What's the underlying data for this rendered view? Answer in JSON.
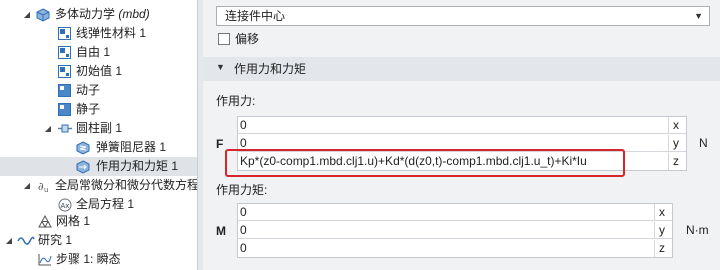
{
  "tree": {
    "items": [
      {
        "label": "多体动力学",
        "suffix": "(mbd)",
        "icon": "multibody-icon"
      },
      {
        "label": "线弹性材料 1",
        "icon": "material-icon"
      },
      {
        "label": "自由 1",
        "icon": "constraint-icon"
      },
      {
        "label": "初始值 1",
        "icon": "initial-values-icon"
      },
      {
        "label": "动子",
        "icon": "domain-icon"
      },
      {
        "label": "静子",
        "icon": "domain-icon"
      },
      {
        "label": "圆柱副 1",
        "icon": "cylindrical-joint-icon"
      },
      {
        "label": "弹簧阻尼器 1",
        "icon": "spring-damper-icon"
      },
      {
        "label": "作用力和力矩 1",
        "icon": "applied-force-icon"
      },
      {
        "label": "全局常微分和微分代数方程",
        "icon": "ode-icon"
      },
      {
        "label": "全局方程 1",
        "icon": "global-equation-icon"
      },
      {
        "label": "网格 1",
        "icon": "mesh-icon"
      },
      {
        "label": "研究 1",
        "icon": "study-icon"
      },
      {
        "label": "步骤 1: 瞬态",
        "icon": "time-step-icon"
      }
    ]
  },
  "panel": {
    "selector_value": "连接件中心",
    "offset_label": "偏移",
    "offset_checked": false,
    "section_title": "作用力和力矩",
    "force": {
      "label": "作用力:",
      "symbol": "F",
      "unit": "N",
      "rows": [
        {
          "value": "0",
          "component": "x"
        },
        {
          "value": "0",
          "component": "y"
        },
        {
          "value": "Kp*(z0-comp1.mbd.clj1.u)+Kd*(d(z0,t)-comp1.mbd.clj1.u_t)+Ki*Iu",
          "component": "z"
        }
      ]
    },
    "moment": {
      "label": "作用力矩:",
      "symbol": "M",
      "unit": "N·m",
      "rows": [
        {
          "value": "0",
          "component": "x"
        },
        {
          "value": "0",
          "component": "y"
        },
        {
          "value": "0",
          "component": "z"
        }
      ]
    }
  },
  "colors": {
    "highlight": "#d6262c",
    "selection": "#dfe2e6",
    "icon_blue": "#2f6fb5"
  }
}
